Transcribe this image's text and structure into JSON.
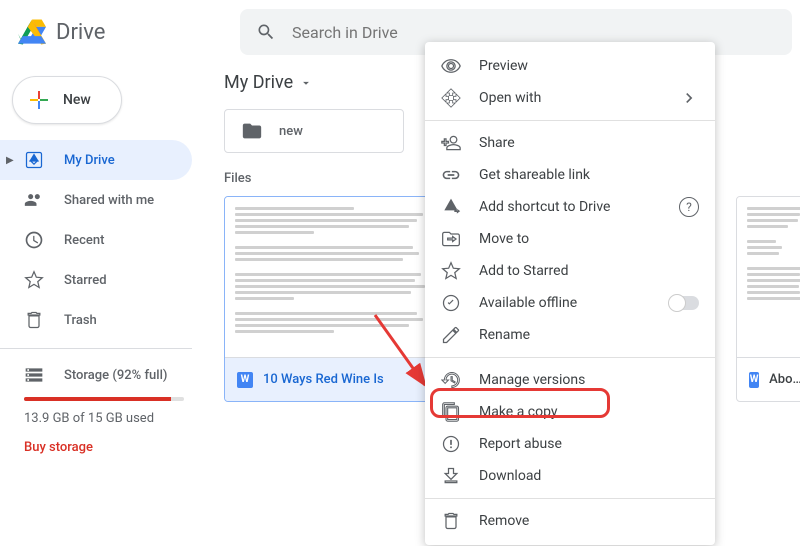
{
  "app": {
    "title": "Drive"
  },
  "search": {
    "placeholder": "Search in Drive"
  },
  "sidebar": {
    "new_label": "New",
    "items": [
      {
        "label": "My Drive"
      },
      {
        "label": "Shared with me"
      },
      {
        "label": "Recent"
      },
      {
        "label": "Starred"
      },
      {
        "label": "Trash"
      }
    ],
    "storage": {
      "label": "Storage (92% full)",
      "used_text": "13.9 GB of 15 GB used",
      "buy_label": "Buy storage",
      "percent": 92
    }
  },
  "main": {
    "breadcrumb": "My Drive",
    "folder": {
      "name": "new"
    },
    "files_label": "Files",
    "files": [
      {
        "name": "10 Ways Red Wine Is",
        "type_badge": "W"
      },
      {
        "name": "About Us",
        "type_badge": "W"
      }
    ]
  },
  "context_menu": {
    "items": [
      {
        "label": "Preview",
        "icon": "eye"
      },
      {
        "label": "Open with",
        "icon": "open-with",
        "chevron": true
      },
      {
        "divider": true
      },
      {
        "label": "Share",
        "icon": "share"
      },
      {
        "label": "Get shareable link",
        "icon": "link"
      },
      {
        "label": "Add shortcut to Drive",
        "icon": "drive-shortcut",
        "help": true
      },
      {
        "label": "Move to",
        "icon": "move"
      },
      {
        "label": "Add to Starred",
        "icon": "star"
      },
      {
        "label": "Available offline",
        "icon": "offline",
        "toggle": true
      },
      {
        "label": "Rename",
        "icon": "rename"
      },
      {
        "divider": true
      },
      {
        "label": "Manage versions",
        "icon": "versions"
      },
      {
        "label": "Make a copy",
        "icon": "copy",
        "highlighted": true
      },
      {
        "label": "Report abuse",
        "icon": "report"
      },
      {
        "label": "Download",
        "icon": "download"
      },
      {
        "divider": true
      },
      {
        "label": "Remove",
        "icon": "trash"
      }
    ]
  }
}
